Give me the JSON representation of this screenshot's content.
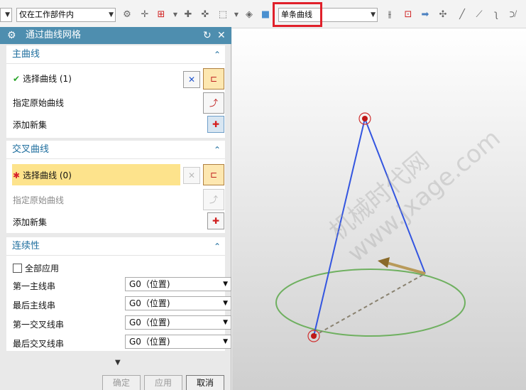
{
  "toolbar": {
    "filter_value": "仅在工作部件内",
    "curve_rule_value": "单条曲线"
  },
  "dialog": {
    "title": "通过曲线网格",
    "primary": {
      "header": "主曲线",
      "select_curve": "选择曲线 (1)",
      "specify_origin": "指定原始曲线",
      "add_new_set": "添加新集"
    },
    "cross": {
      "header": "交叉曲线",
      "select_curve": "选择曲线 (0)",
      "specify_origin": "指定原始曲线",
      "add_new_set": "添加新集"
    },
    "continuity": {
      "header": "连续性",
      "apply_all": "全部应用",
      "rows": [
        {
          "label": "第一主线串",
          "value": "G0（位置)"
        },
        {
          "label": "最后主线串",
          "value": "G0（位置)"
        },
        {
          "label": "第一交叉线串",
          "value": "G0（位置)"
        },
        {
          "label": "最后交叉线串",
          "value": "G0（位置)"
        }
      ]
    },
    "buttons": {
      "ok": "确定",
      "apply": "应用",
      "cancel": "取消"
    }
  },
  "viewport": {
    "watermark_line1": "机械时代网",
    "watermark_line2": "www.jxage.com"
  },
  "colors": {
    "title_bar": "#4e8eaf",
    "header_text": "#1e6e9e",
    "highlight": "#fde38c",
    "red_box": "#e0202a",
    "blue_curve": "#3355e0",
    "green_circle": "#6fb060",
    "arrow": "#b89a5a"
  }
}
